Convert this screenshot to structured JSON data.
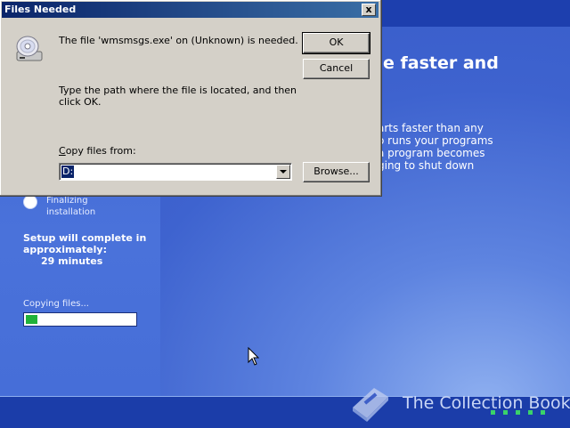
{
  "setup": {
    "headline": "e faster and",
    "body_lines": [
      "arts faster than any",
      "o runs your programs",
      "a program becomes",
      "ging to shut down"
    ],
    "step_label_line1": "Finalizing",
    "step_label_line2": "installation",
    "complete_line1": "Setup will complete in",
    "complete_line2": "approximately:",
    "minutes": "29 minutes",
    "copying_label": "Copying files...",
    "progress_fraction": 0.11,
    "watermark": "The Collection Book"
  },
  "dialog": {
    "title": "Files Needed",
    "close_label": "x",
    "message_needed": "The file 'wmsmsgs.exe' on (Unknown) is needed.",
    "message_path": "Type the path where the file is located, and then click OK.",
    "copy_from_label_prefix": "C",
    "copy_from_label_rest": "opy files from:",
    "copy_from_value": "D:",
    "ok_label": "OK",
    "cancel_label": "Cancel",
    "browse_label": "Browse..."
  },
  "colors": {
    "setup_blue": "#3a5cc7",
    "titlebar_start": "#0a246a",
    "titlebar_end": "#3a6ea5",
    "progress_green": "#21b23a",
    "dialog_face": "#d4d0c8"
  },
  "icons": {
    "dialog_icon": "cd-drive-icon",
    "combo_arrow": "chevron-down-icon",
    "watermark_icon": "book-icon",
    "pointer": "mouse-cursor-icon"
  }
}
